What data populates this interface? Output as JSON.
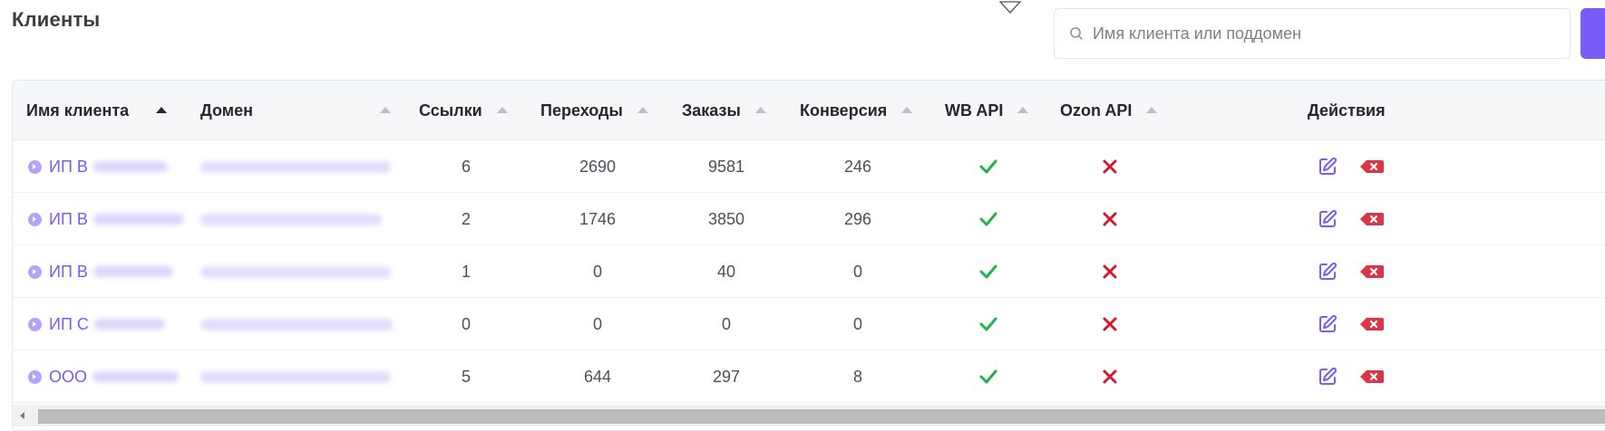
{
  "page": {
    "title": "Клиенты"
  },
  "search": {
    "placeholder": "Имя клиента или поддомен"
  },
  "table": {
    "columns": [
      {
        "key": "client",
        "label": "Имя клиента",
        "sort_active": true
      },
      {
        "key": "domain",
        "label": "Домен",
        "sort_active": false
      },
      {
        "key": "links",
        "label": "Ссылки",
        "sort_active": false
      },
      {
        "key": "clicks",
        "label": "Переходы",
        "sort_active": false
      },
      {
        "key": "orders",
        "label": "Заказы",
        "sort_active": false
      },
      {
        "key": "conversion",
        "label": "Конверсия",
        "sort_active": false
      },
      {
        "key": "wb_api",
        "label": "WB API",
        "sort_active": false
      },
      {
        "key": "ozon_api",
        "label": "Ozon API",
        "sort_active": false
      },
      {
        "key": "actions",
        "label": "Действия"
      }
    ],
    "rows": [
      {
        "client_prefix": "ИП В",
        "links": "6",
        "clicks": "2690",
        "orders": "9581",
        "conversion": "246",
        "wb_api": "check-icon",
        "ozon_api": "cross-icon"
      },
      {
        "client_prefix": "ИП В",
        "links": "2",
        "clicks": "1746",
        "orders": "3850",
        "conversion": "296",
        "wb_api": "check-icon",
        "ozon_api": "cross-icon"
      },
      {
        "client_prefix": "ИП В",
        "links": "1",
        "clicks": "0",
        "orders": "40",
        "conversion": "0",
        "wb_api": "check-icon",
        "ozon_api": "cross-icon"
      },
      {
        "client_prefix": "ИП С",
        "links": "0",
        "clicks": "0",
        "orders": "0",
        "conversion": "0",
        "wb_api": "check-icon",
        "ozon_api": "cross-icon"
      },
      {
        "client_prefix": "ООО",
        "links": "5",
        "clicks": "644",
        "orders": "297",
        "conversion": "8",
        "wb_api": "check-icon",
        "ozon_api": "cross-icon"
      }
    ]
  },
  "colors": {
    "accent": "#7a5af8",
    "check": "#22b14c",
    "cross": "#d11a2a",
    "delete": "#dc3545"
  },
  "icons": {
    "search": "search-icon",
    "edit": "edit-icon",
    "delete": "delete-icon",
    "client": "chevron-circle-icon"
  }
}
